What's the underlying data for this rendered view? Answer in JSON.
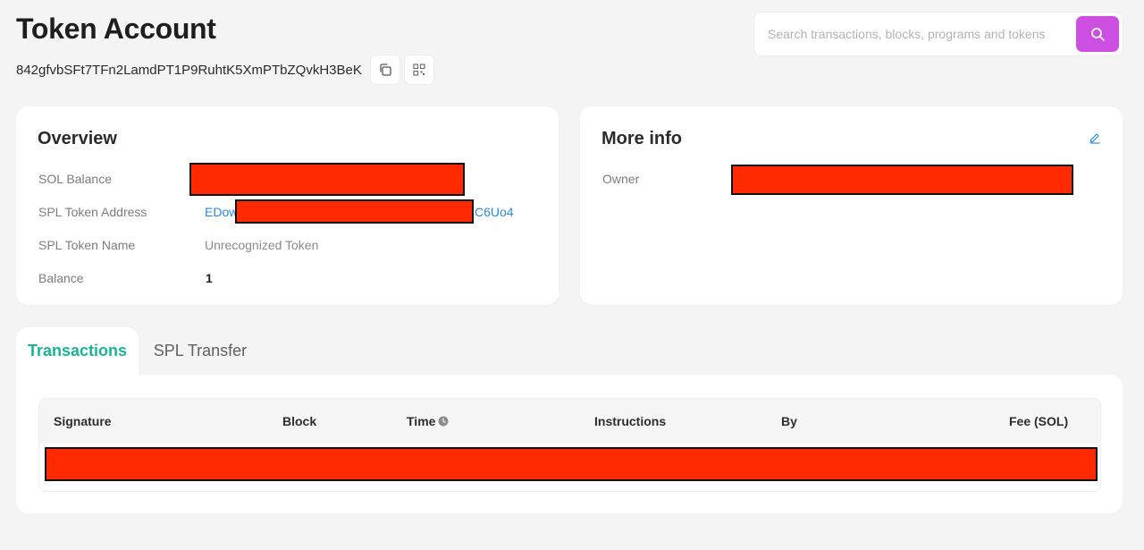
{
  "header": {
    "title": "Token Account",
    "address": "842gfvbSFt7TFn2LamdPT1P9RuhtK5XmPTbZQvkH3BeK"
  },
  "search": {
    "placeholder": "Search transactions, blocks, programs and tokens"
  },
  "overview": {
    "title": "Overview",
    "rows": [
      {
        "label": "SOL Balance",
        "value": ""
      },
      {
        "label": "SPL Token Address",
        "value_prefix": "EDow",
        "value_suffix": "C6Uo4"
      },
      {
        "label": "SPL Token Name",
        "value": "Unrecognized Token"
      },
      {
        "label": "Balance",
        "value": "1"
      }
    ]
  },
  "more_info": {
    "title": "More info",
    "rows": [
      {
        "label": "Owner",
        "value": ""
      }
    ]
  },
  "tabs": [
    {
      "label": "Transactions",
      "active": true
    },
    {
      "label": "SPL Transfer",
      "active": false
    }
  ],
  "table": {
    "columns": [
      "Signature",
      "Block",
      "Time",
      "Instructions",
      "By",
      "Fee (SOL)"
    ]
  },
  "colors": {
    "accent_green": "#1cb497",
    "search_button": "#cd4fe2",
    "link_blue": "#2a8ad7",
    "redaction": "#ff2a00"
  },
  "icons": {
    "copy": "copy-icon",
    "qr": "qr-code-icon",
    "search": "search-icon",
    "edit": "edit-icon",
    "clock": "clock-icon"
  }
}
